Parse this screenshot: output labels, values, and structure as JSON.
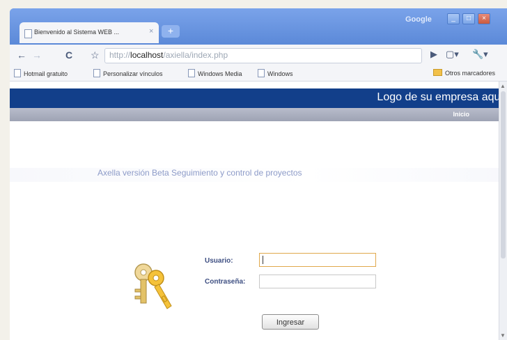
{
  "browser": {
    "google_label": "Google",
    "window_buttons": [
      "_",
      "□",
      "×"
    ],
    "tab": {
      "title": "Bienvenido al Sistema WEB ...",
      "close": "×"
    },
    "new_tab": "+",
    "nav": {
      "back": "←",
      "forward": "→",
      "reload": "C",
      "star": "☆"
    },
    "address": {
      "protocol": "http://",
      "host": "localhost",
      "path": "/axiella/index.php"
    },
    "tools": {
      "play": "▶",
      "page": "▢▾",
      "wrench": "🔧▾"
    },
    "bookmarks": [
      "Hotmail gratuito",
      "Personalizar vínculos",
      "Windows Media",
      "Windows"
    ],
    "other_bookmarks": "Otros marcadores"
  },
  "page": {
    "logo_text": "Logo de su empresa aqui",
    "nav_link": "Inicio",
    "subtitle": "Axella versión Beta Seguimiento y control de proyectos",
    "login": {
      "user_label": "Usuario:",
      "password_label": "Contraseña:",
      "user_value": "",
      "password_value": "",
      "submit_label": "Ingresar"
    }
  },
  "colors": {
    "header_band": "#123f8a",
    "nav_band": "#a9adbd",
    "label_text": "#3e4f82",
    "subtitle_text": "#8d9bc8"
  },
  "icons": [
    "keys-icon",
    "page-icon",
    "folder-icon",
    "star-icon",
    "reload-icon"
  ]
}
